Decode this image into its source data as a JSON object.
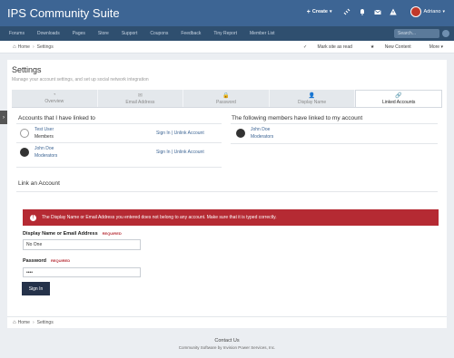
{
  "header": {
    "site_title": "IPS Community Suite",
    "create_label": "Create",
    "user_name": "Adriano"
  },
  "nav": {
    "items": [
      "Forums",
      "Downloads",
      "Pages",
      "Store",
      "Support",
      "Coupons",
      "Feedback",
      "Tiny Report",
      "Member List"
    ],
    "search_placeholder": "Search..."
  },
  "breadcrumb": {
    "home": "Home",
    "current": "Settings",
    "mark_read": "Mark site as read",
    "new_content": "New Content",
    "more": "More"
  },
  "page": {
    "title": "Settings",
    "subtitle": "Manage your account settings, and set up social network integration"
  },
  "tabs": [
    {
      "label": "Overview",
      "icon": "gauge-icon",
      "glyph": "◔"
    },
    {
      "label": "Email Address",
      "icon": "envelope-icon",
      "glyph": "✉"
    },
    {
      "label": "Password",
      "icon": "lock-icon",
      "glyph": "🔒"
    },
    {
      "label": "Display Name",
      "icon": "user-icon",
      "glyph": "👤"
    },
    {
      "label": "Linked Accounts",
      "icon": "link-icon",
      "glyph": "🔗",
      "active": true
    }
  ],
  "linked": {
    "left_heading": "Accounts that I have linked to",
    "right_heading": "The following members have linked to my account",
    "left_rows": [
      {
        "name": "Test User",
        "group": "Members",
        "actions": "Sign In | Unlink Account"
      },
      {
        "name": "John Doe",
        "group": "Moderators",
        "actions": "Sign In | Unlink Account"
      }
    ],
    "right_rows": [
      {
        "name": "John Doe",
        "group": "Moderators"
      }
    ]
  },
  "link_form": {
    "heading": "Link an Account",
    "error": "The Display Name or Email Address you entered does not belong to any account. Make sure that it is typed correctly.",
    "name_label": "Display Name or Email Address",
    "name_value": "No One",
    "password_label": "Password",
    "password_value": "••••",
    "required": "REQUIRED",
    "submit": "Sign In"
  },
  "footer": {
    "contact": "Contact Us",
    "powered": "Community Software by Invision Power Services, Inc."
  },
  "colors": {
    "header": "#3d6594",
    "navbar": "#2f4f6f",
    "error": "#b52a33",
    "button": "#25324a"
  }
}
